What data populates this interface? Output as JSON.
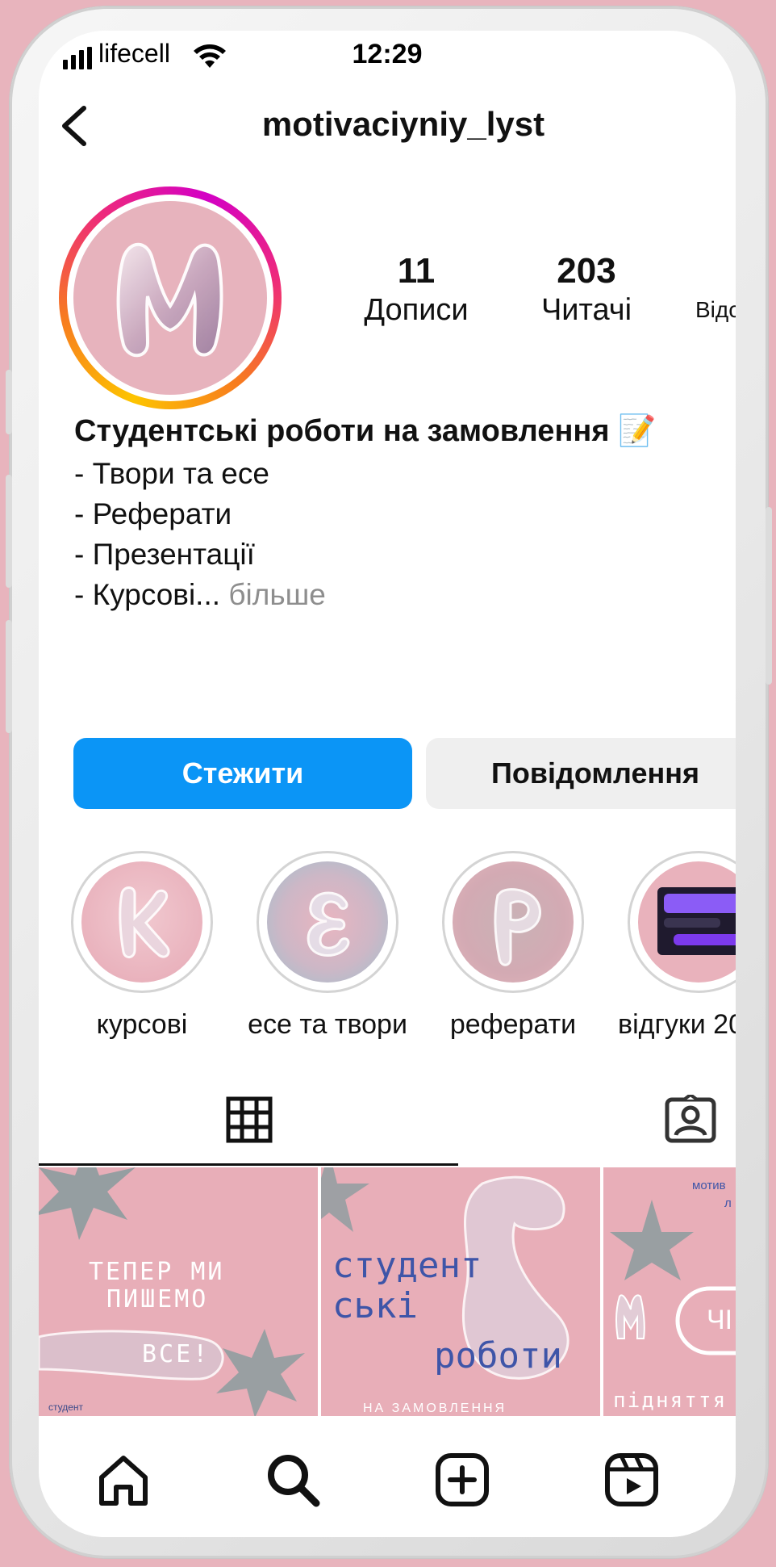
{
  "status_bar": {
    "carrier": "lifecell",
    "time": "12:29"
  },
  "header": {
    "username": "motivaciyniy_lyst"
  },
  "profile": {
    "avatar_letter": "M",
    "stats": [
      {
        "value": "11",
        "label": "Дописи"
      },
      {
        "value": "203",
        "label": "Читачі"
      },
      {
        "value": "",
        "label": "Відс"
      }
    ]
  },
  "bio": {
    "title": "Студентські роботи на замовлення 📝",
    "lines": [
      "- Твори та есе",
      "- Реферати",
      "- Презентації",
      "- Курсові..."
    ],
    "more_label": "більше"
  },
  "actions": {
    "follow_label": "Стежити",
    "message_label": "Повідомлення"
  },
  "highlights": [
    {
      "label": "курсові",
      "letter": "К"
    },
    {
      "label": "есе та твори",
      "letter": "Е"
    },
    {
      "label": "реферати",
      "letter": "Р"
    },
    {
      "label": "відгуки 20"
    }
  ],
  "posts": [
    {
      "line1": "ТЕПЕР МИ",
      "line2": "ПИШЕМО",
      "line3": "ВСЕ!",
      "footer": "студент"
    },
    {
      "line1": "студент",
      "line2": "ські",
      "line3": "роботи",
      "footer": "НА ЗАМОВЛЕННЯ"
    },
    {
      "line1": "мотив",
      "line2": "л",
      "line3": "піднят­тя",
      "button": "ЧІ"
    }
  ],
  "colors": {
    "follow_button": "#0b95f6",
    "post_background": "#e8aeb8",
    "background": "#e8b4bd"
  },
  "icons": {
    "nav": [
      "home-icon",
      "search-icon",
      "create-icon",
      "reels-icon"
    ],
    "tabs": [
      "grid-icon",
      "tagged-icon"
    ]
  }
}
